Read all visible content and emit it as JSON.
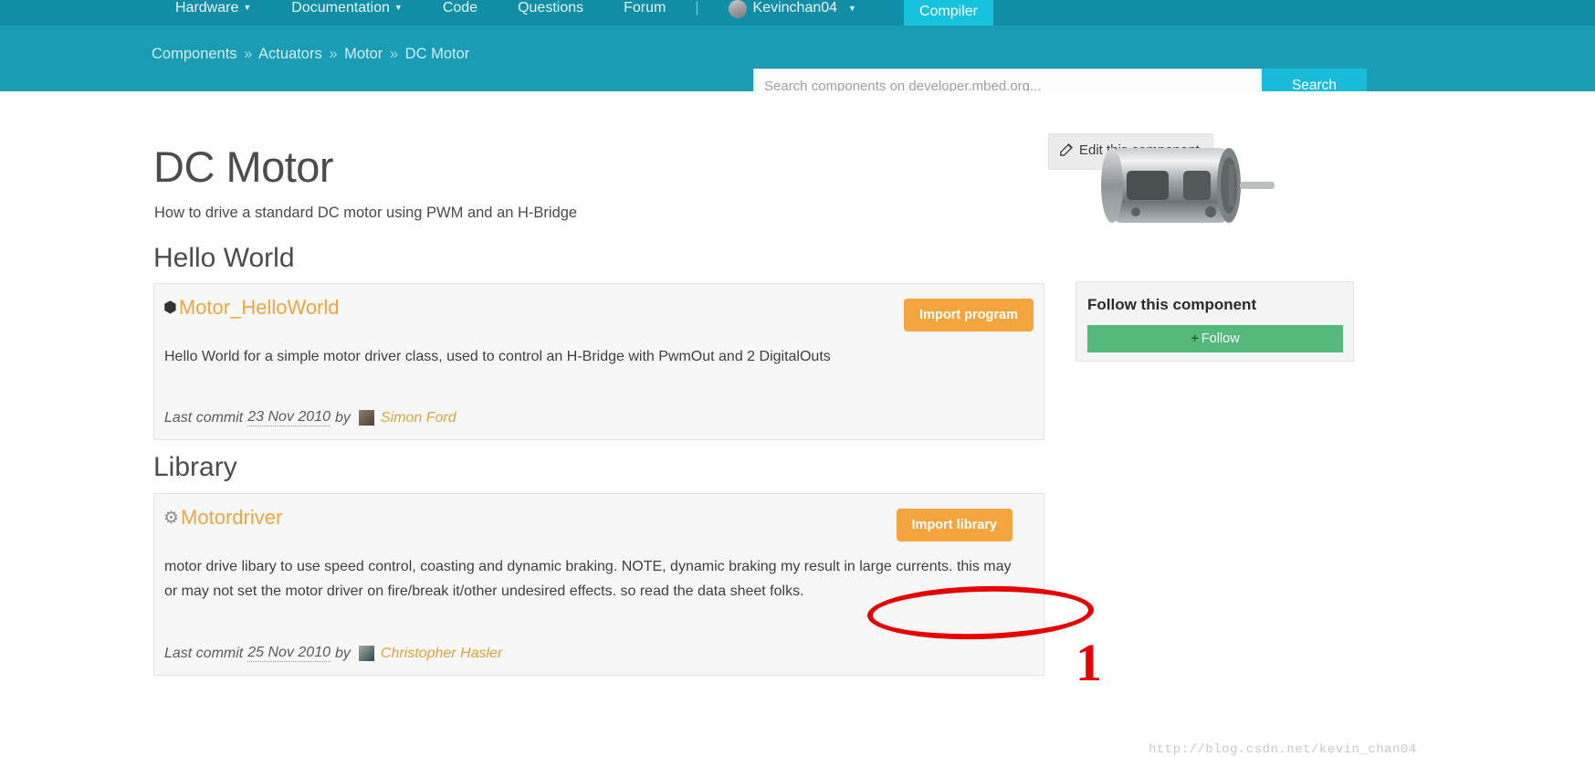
{
  "topnav": {
    "items": [
      {
        "label": "Hardware",
        "has_caret": true
      },
      {
        "label": "Documentation",
        "has_caret": true
      },
      {
        "label": "Code",
        "has_caret": false
      },
      {
        "label": "Questions",
        "has_caret": false
      },
      {
        "label": "Forum",
        "has_caret": false
      }
    ],
    "separator": "|",
    "user": "Kevinchan04",
    "user_caret": "▾",
    "compiler_label": "Compiler",
    "avatar_icon": "user-avatar-icon"
  },
  "subbar": {
    "breadcrumb": [
      "Components",
      "Actuators",
      "Motor",
      "DC Motor"
    ],
    "breadcrumb_separator": "»",
    "search": {
      "value": "",
      "placeholder": "Search components on developer.mbed.org...",
      "button_label": "Search"
    }
  },
  "main": {
    "edit_button": {
      "label": "Edit this component",
      "icon": "edit-pencil-icon"
    },
    "title": "DC Motor",
    "tagline": "How to drive a standard DC motor using PWM and an H-Bridge",
    "sections": [
      {
        "heading": "Hello World",
        "card": {
          "icon": "cube-icon",
          "icon_glyph": "⬢",
          "title": "Motor_HelloWorld",
          "button_label": "Import program",
          "description": "Hello World for a simple motor driver class, used to control an H-Bridge with PwmOut and 2 DigitalOuts",
          "commit_prefix": "Last commit",
          "commit_date": "23 Nov 2010",
          "commit_by": "by",
          "commit_author": "Simon Ford"
        }
      },
      {
        "heading": "Library",
        "card": {
          "icon": "gear-icon",
          "icon_glyph": "⚙",
          "title": "Motordriver",
          "button_label": "Import library",
          "description": "motor drive libary to use speed control, coasting and dynamic braking. NOTE, dynamic braking my result in large currents. this may or may not set the motor driver on fire/break it/other undesired effects. so read the data sheet folks.",
          "commit_prefix": "Last commit",
          "commit_date": "25 Nov 2010",
          "commit_by": "by",
          "commit_author": "Christopher Hasler"
        }
      }
    ]
  },
  "sidebar": {
    "photo_alt": "dc-motor-photo",
    "follow_title": "Follow this component",
    "follow_button_label": "Follow",
    "follow_plus": "+"
  },
  "annotation": {
    "number": "1",
    "shape": "red-ellipse"
  },
  "watermark": "http://blog.csdn.net/kevin_chan04",
  "colors": {
    "nav_bg": "#118ea6",
    "subbar_bg": "#1a9cb5",
    "compiler_bg": "#17c2de",
    "search_btn": "#19bcd8",
    "accent_orange": "#f5a540",
    "link_orange": "#f0a53e",
    "follow_green": "#55b97c",
    "annotation_red": "#e60000"
  }
}
